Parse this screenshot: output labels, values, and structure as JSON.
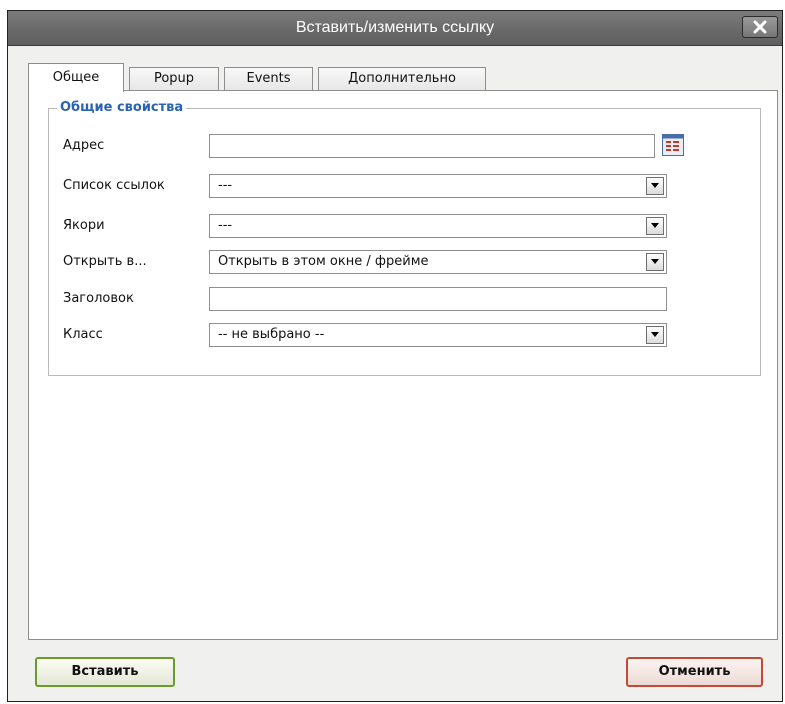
{
  "dialog": {
    "title": "Вставить/изменить ссылку"
  },
  "tabs": [
    {
      "label": "Общее",
      "active": true
    },
    {
      "label": "Popup",
      "active": false
    },
    {
      "label": "Events",
      "active": false
    },
    {
      "label": "Дополнительно",
      "active": false
    }
  ],
  "general": {
    "legend": "Общие свойства",
    "address": {
      "label": "Адрес",
      "value": ""
    },
    "link_list": {
      "label": "Список ссылок",
      "value": "---"
    },
    "anchors": {
      "label": "Якори",
      "value": "---"
    },
    "target": {
      "label": "Открыть в...",
      "value": "Открыть в этом окне / фрейме"
    },
    "title": {
      "label": "Заголовок",
      "value": ""
    },
    "class": {
      "label": "Класс",
      "value": "-- не выбрано --"
    }
  },
  "buttons": {
    "insert": "Вставить",
    "cancel": "Отменить"
  },
  "icons": {
    "close": "close-icon",
    "browse": "file-browser-icon",
    "dropdown": "dropdown-arrow-icon"
  },
  "colors": {
    "titlebar": "#6e6e6e",
    "legend": "#2a63b3",
    "insert_border": "#6a9c2c",
    "cancel_border": "#c24a37"
  }
}
